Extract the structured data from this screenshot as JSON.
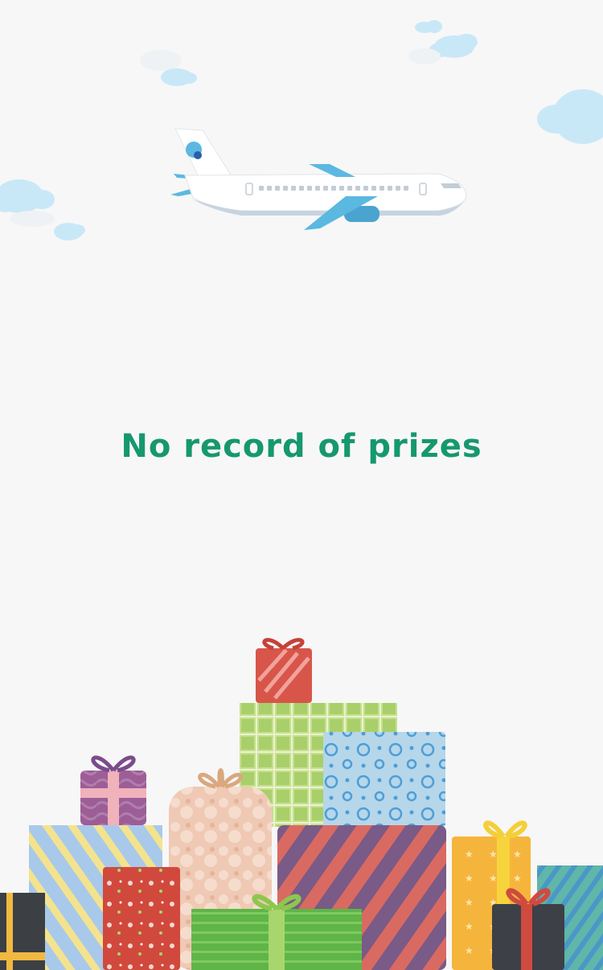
{
  "empty_state": {
    "message": "No record of prizes"
  },
  "icons": {
    "airplane": "airplane-illustration",
    "clouds": "cloud-illustration",
    "gifts": "gift-boxes-illustration"
  },
  "colors": {
    "message": "#16986f",
    "background": "#f7f7f7",
    "cloud": "#c5e6f6",
    "plane_accent": "#5bb8e0"
  }
}
